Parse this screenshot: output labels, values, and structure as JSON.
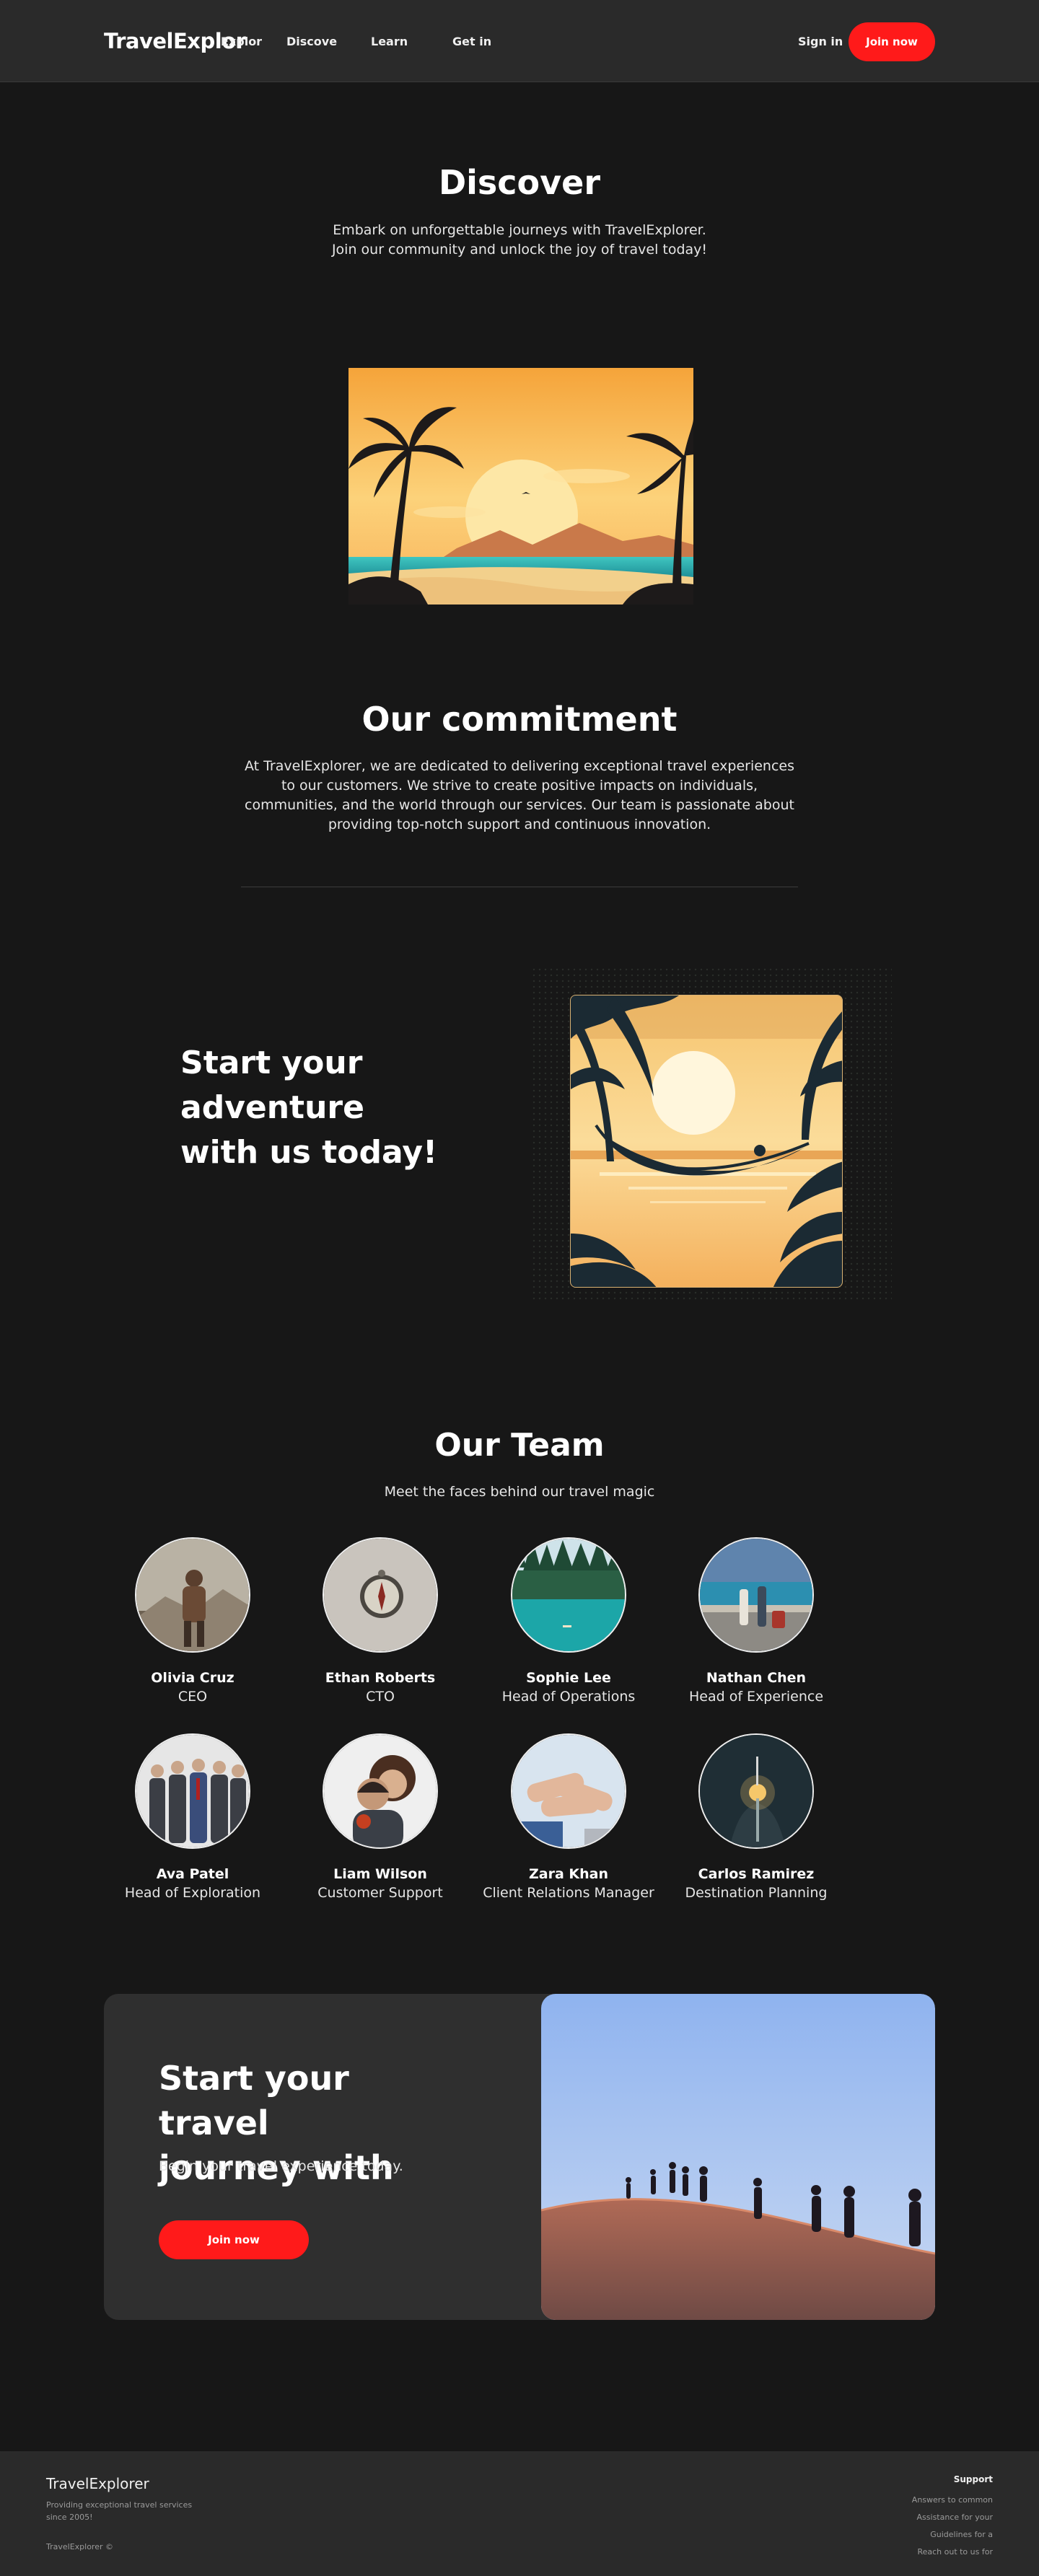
{
  "nav": {
    "brand": "TravelExplor",
    "links": [
      "Explor",
      "Discove",
      "Learn",
      "Get in"
    ],
    "signin": "Sign in",
    "join": "Join now"
  },
  "discover": {
    "title": "Discover",
    "line1": "Embark on unforgettable journeys with TravelExplorer.",
    "line2": "Join our community and unlock the joy of travel today!"
  },
  "commitment": {
    "title": "Our commitment",
    "text": "At TravelExplorer, we are dedicated to delivering exceptional travel experiences to our customers. We strive to create positive impacts on individuals, communities, and the world through our services. Our team is passionate about providing top-notch support and continuous innovation."
  },
  "adventure": {
    "line1": "Start your",
    "line2": "adventure",
    "line3": "with us today!"
  },
  "team": {
    "title": "Our Team",
    "subtitle": "Meet the faces behind our travel magic",
    "members": [
      {
        "name": "Olivia Cruz",
        "role": "CEO",
        "image": "hiker-photo"
      },
      {
        "name": "Ethan Roberts",
        "role": "CTO",
        "image": "compass-photo"
      },
      {
        "name": "Sophie Lee",
        "role": "Head of Operations",
        "image": "lake-forest-photo"
      },
      {
        "name": "Nathan Chen",
        "role": "Head of Experience",
        "image": "travelers-coast-photo"
      },
      {
        "name": "Ava Patel",
        "role": "Head of Exploration",
        "image": "business-group-photo"
      },
      {
        "name": "Liam Wilson",
        "role": "Customer Support",
        "image": "couple-photo"
      },
      {
        "name": "Zara Khan",
        "role": "Client Relations Manager",
        "image": "stacked-hands-photo"
      },
      {
        "name": "Carlos Ramirez",
        "role": "Destination Planning",
        "image": "hands-lights-photo"
      }
    ]
  },
  "cta": {
    "line1": "Start your travel",
    "line2": "journey with",
    "text": "Begin your travel experience today.",
    "button": "Join now"
  },
  "footer": {
    "brand": "TravelExplorer",
    "desc": "Providing exceptional travel services since 2005!",
    "copyright": "TravelExplorer ©",
    "col_title": "Support",
    "links": [
      "Answers to common",
      "Assistance for your",
      "Guidelines for a",
      "Reach out to us for"
    ]
  },
  "colors": {
    "accent": "#ff1a1a",
    "background": "#171717",
    "surface": "#2a2a2a"
  }
}
